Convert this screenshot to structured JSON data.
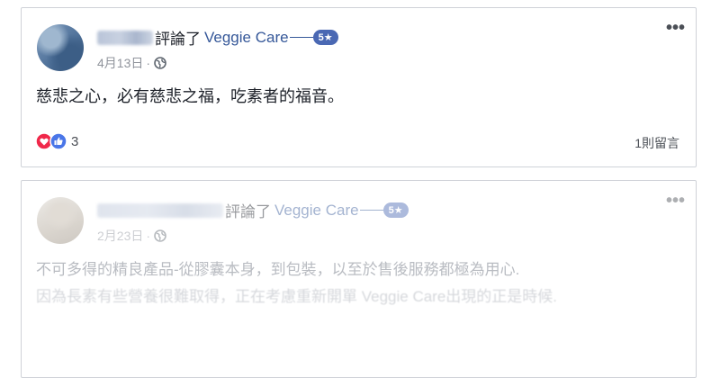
{
  "posts": [
    {
      "header": {
        "verb": "評論了",
        "page_name": "Veggie Care",
        "rating_badge": "5★"
      },
      "meta": {
        "date": "4月13日",
        "separator": "·",
        "privacy_icon": "globe-icon"
      },
      "text": "慈悲之心，必有慈悲之福，吃素者的福音。",
      "reactions": {
        "icons": [
          "love-icon",
          "like-icon"
        ],
        "count": "3"
      },
      "comments_link": "1則留言",
      "more_icon": "more-options-icon"
    },
    {
      "header": {
        "verb": "評論了",
        "page_name": "Veggie Care",
        "rating_badge": "5★"
      },
      "meta": {
        "date": "2月23日",
        "separator": "·",
        "privacy_icon": "globe-icon"
      },
      "text": "不可多得的精良產品-從膠囊本身，到包裝，以至於售後服務都極為用心.",
      "text_line2": "因為長素有些營養很難取得，正在考慮重新開單 Veggie Care出現的正是時候.",
      "more_icon": "more-options-icon"
    }
  ],
  "colors": {
    "link": "#365899",
    "badge": "#4a68b3",
    "text": "#1d2129",
    "meta": "#90949c",
    "border": "#cfd2d8",
    "love": "#f0284a",
    "like": "#4a76e8"
  }
}
